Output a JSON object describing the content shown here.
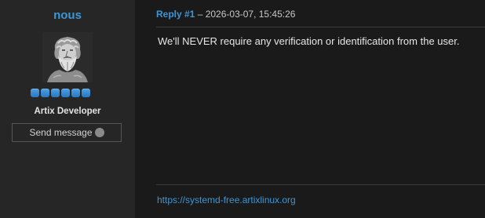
{
  "author": {
    "username": "nous",
    "title": "Artix Developer",
    "rank_dots": 6,
    "send_message_label": "Send message",
    "online_status": "offline"
  },
  "post": {
    "reply_label": "Reply #1",
    "separator": " – ",
    "timestamp": "2026-03-07, 15:45:26",
    "body": "We'll NEVER require any verification or identification from the user.",
    "signature_link": "https://systemd-free.artixlinux.org"
  },
  "colors": {
    "link": "#3d96d6",
    "rank_dot": "#3a8ad2",
    "status_offline": "#8a8a8a"
  },
  "icons": {
    "avatar": "bearded-bust-avatar",
    "status": "status-dot-icon"
  }
}
